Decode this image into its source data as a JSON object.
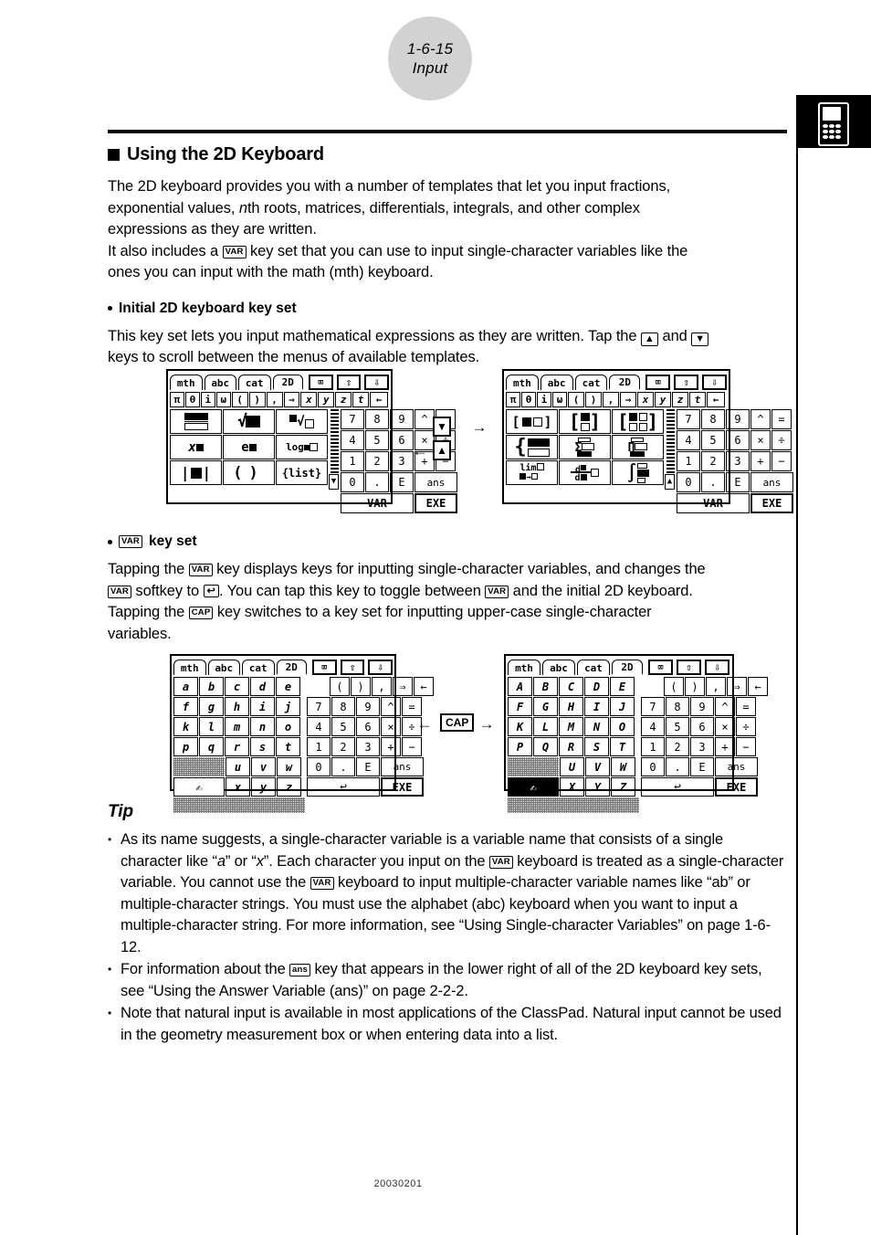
{
  "header": {
    "page_number": "1-6-15",
    "section": "Input",
    "tab_icon": "calculator-icon"
  },
  "footer": {
    "doc_code": "20030201"
  },
  "section": {
    "heading": "Using the 2D Keyboard",
    "intro_line1": "The 2D keyboard provides you with a number of templates that let you input fractions,",
    "intro_line2_a": "exponential values, ",
    "intro_line2_n": "n",
    "intro_line2_b": "th roots, matrices, differentials, integrals, and other complex",
    "intro_line3": "expressions as they are written.",
    "intro_line4_a": "It also includes a ",
    "intro_line4_key": "VAR",
    "intro_line4_b": " key set that you can use to input single-character variables like the",
    "intro_line5": "ones you can input with the math (mth) keyboard."
  },
  "initial_keyset": {
    "heading": "Initial 2D keyboard key set",
    "line1_a": "This key set lets you input mathematical expressions as they are written. Tap the ",
    "line1_up": "▲",
    "line1_b": " and ",
    "line1_down": "▼",
    "line2": "keys to scroll between the menus of available templates."
  },
  "var_keyset": {
    "heading_key": "VAR",
    "heading_text": "key set",
    "line1_a": "Tapping the ",
    "line1_key": "VAR",
    "line1_b": " key displays keys for inputting single-character variables, and changes the",
    "line2_key1": "VAR",
    "line2_a": " softkey to ",
    "line2_key2": "↩",
    "line2_b": ". You can tap this key to toggle between ",
    "line2_key3": "VAR",
    "line2_c": " and the initial 2D keyboard.",
    "line3_a": "Tapping the ",
    "line3_key": "CAP",
    "line3_b": " key switches to a key set for inputting upper-case single-character",
    "line4": "variables."
  },
  "tip": {
    "heading": "Tip",
    "items": [
      {
        "parts": [
          {
            "t": "As its name suggests, a single-character variable is a variable name that consists of a single character like “",
            "k": false
          },
          {
            "t": "a",
            "k": false,
            "i": true
          },
          {
            "t": "” or “",
            "k": false
          },
          {
            "t": "x",
            "k": false,
            "i": true
          },
          {
            "t": "”. Each character you input on the ",
            "k": false
          },
          {
            "t": "VAR",
            "k": true
          },
          {
            "t": " keyboard is treated as a single-character variable. You cannot use the ",
            "k": false
          },
          {
            "t": "VAR",
            "k": true
          },
          {
            "t": " keyboard to input multiple-character variable names like “ab” or multiple-character strings. You must use the alphabet (abc) keyboard when you want to input a multiple-character string. For more information, see “Using Single-character Variables” on page 1-6-12.",
            "k": false
          }
        ]
      },
      {
        "parts": [
          {
            "t": "For information about the ",
            "k": false
          },
          {
            "t": "ans",
            "k": true
          },
          {
            "t": " key that appears in the lower right of all of the 2D keyboard key sets, see “Using the Answer Variable (ans)” on page 2-2-2.",
            "k": false
          }
        ]
      },
      {
        "parts": [
          {
            "t": "Note that natural input is available in most applications of the ClassPad. Natural input cannot be used in the geometry measurement box or when entering data into a list.",
            "k": false
          }
        ]
      }
    ]
  },
  "keyboards": {
    "tabs": [
      "mth",
      "abc",
      "cat",
      "2D"
    ],
    "selected_tab": "2D",
    "icon_keys": [
      "⌧",
      "⇧",
      "⇩"
    ],
    "symbol_row": [
      "π",
      "θ",
      "i",
      "ω",
      "(",
      ")",
      ",",
      "⇒",
      "x",
      "y",
      "z",
      "t",
      "←"
    ],
    "numpad": [
      "7",
      "8",
      "9",
      "4",
      "5",
      "6",
      "1",
      "2",
      "3",
      "0",
      ".",
      "E"
    ],
    "oper_col": [
      "^",
      "=",
      "×",
      "÷",
      "+",
      "−"
    ],
    "ans_key": "ans",
    "var_key": "VAR",
    "exe_key": "EXE",
    "return_key": "↩",
    "scroll_down_key": "▼",
    "scroll_up_key": "▲",
    "templates_page1": [
      "fraction",
      "square-root",
      "nth-root",
      "x-power",
      "e-power",
      "log-base",
      "absolute-value",
      "parentheses",
      "list-braces"
    ],
    "templates_page2": [
      "matrix-1x2",
      "matrix-2x1",
      "matrix-2x2",
      "piecewise",
      "summation",
      "product",
      "limit",
      "derivative",
      "integral"
    ],
    "lower_letters": [
      [
        "a",
        "b",
        "c",
        "d",
        "e"
      ],
      [
        "f",
        "g",
        "h",
        "i",
        "j"
      ],
      [
        "k",
        "l",
        "m",
        "n",
        "o"
      ],
      [
        "p",
        "q",
        "r",
        "s",
        "t"
      ],
      [
        "u",
        "v",
        "w"
      ],
      [
        "x",
        "y",
        "z"
      ]
    ],
    "upper_letters": [
      [
        "A",
        "B",
        "C",
        "D",
        "E"
      ],
      [
        "F",
        "G",
        "H",
        "I",
        "J"
      ],
      [
        "K",
        "L",
        "M",
        "N",
        "O"
      ],
      [
        "P",
        "Q",
        "R",
        "S",
        "T"
      ],
      [
        "U",
        "V",
        "W"
      ],
      [
        "X",
        "Y",
        "Z"
      ]
    ],
    "punct_row": [
      "(",
      ")",
      ",",
      "⇒",
      "←"
    ],
    "cap_key": "CAP",
    "cap_key_label": "CAP",
    "arrow_right": "→",
    "arrow_left": "←"
  }
}
